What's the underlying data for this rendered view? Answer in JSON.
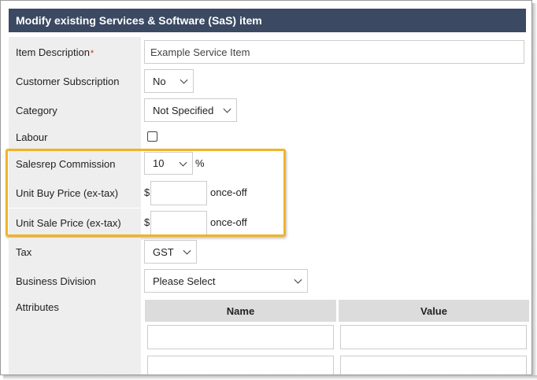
{
  "header": {
    "title": "Modify existing Services & Software (SaS) item"
  },
  "fields": {
    "item_description": {
      "label": "Item Description",
      "required_mark": "*",
      "value": "Example Service Item"
    },
    "customer_subscription": {
      "label": "Customer Subscription",
      "value": "No"
    },
    "category": {
      "label": "Category",
      "value": "Not Specified"
    },
    "labour": {
      "label": "Labour",
      "checked": false
    },
    "salesrep_commission": {
      "label": "Salesrep Commission",
      "value": "10",
      "suffix": "%"
    },
    "unit_buy_price": {
      "label": "Unit Buy Price (ex-tax)",
      "currency": "$",
      "value": "",
      "suffix": "once-off"
    },
    "unit_sale_price": {
      "label": "Unit Sale Price (ex-tax)",
      "currency": "$",
      "value": "",
      "suffix": "once-off"
    },
    "tax": {
      "label": "Tax",
      "value": "GST"
    },
    "business_division": {
      "label": "Business Division",
      "value": "Please Select"
    },
    "attributes": {
      "label": "Attributes",
      "columns": [
        "Name",
        "Value"
      ]
    }
  },
  "colors": {
    "header_bg": "#3b4a62",
    "highlight": "#f0b428",
    "label_bg": "#eeeeee"
  }
}
